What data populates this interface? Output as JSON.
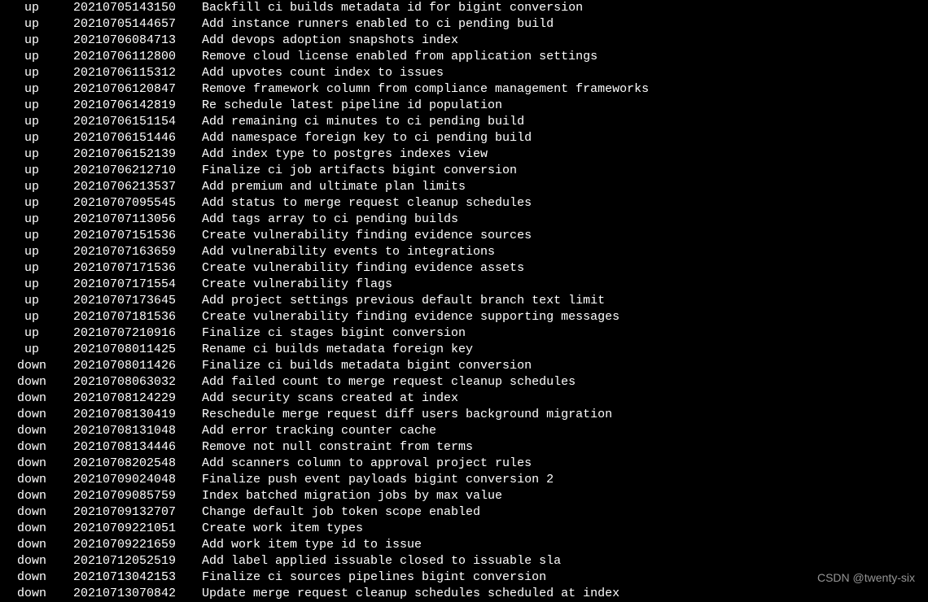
{
  "watermark": "CSDN @twenty-six",
  "rows": [
    {
      "status": "  up",
      "version": "20210705143150",
      "desc": "Backfill ci builds metadata id for bigint conversion"
    },
    {
      "status": "  up",
      "version": "20210705144657",
      "desc": "Add instance runners enabled to ci pending build"
    },
    {
      "status": "  up",
      "version": "20210706084713",
      "desc": "Add devops adoption snapshots index"
    },
    {
      "status": "  up",
      "version": "20210706112800",
      "desc": "Remove cloud license enabled from application settings"
    },
    {
      "status": "  up",
      "version": "20210706115312",
      "desc": "Add upvotes count index to issues"
    },
    {
      "status": "  up",
      "version": "20210706120847",
      "desc": "Remove framework column from compliance management frameworks"
    },
    {
      "status": "  up",
      "version": "20210706142819",
      "desc": "Re schedule latest pipeline id population"
    },
    {
      "status": "  up",
      "version": "20210706151154",
      "desc": "Add remaining ci minutes to ci pending build"
    },
    {
      "status": "  up",
      "version": "20210706151446",
      "desc": "Add namespace foreign key to ci pending build"
    },
    {
      "status": "  up",
      "version": "20210706152139",
      "desc": "Add index type to postgres indexes view"
    },
    {
      "status": "  up",
      "version": "20210706212710",
      "desc": "Finalize ci job artifacts bigint conversion"
    },
    {
      "status": "  up",
      "version": "20210706213537",
      "desc": "Add premium and ultimate plan limits"
    },
    {
      "status": "  up",
      "version": "20210707095545",
      "desc": "Add status to merge request cleanup schedules"
    },
    {
      "status": "  up",
      "version": "20210707113056",
      "desc": "Add tags array to ci pending builds"
    },
    {
      "status": "  up",
      "version": "20210707151536",
      "desc": "Create vulnerability finding evidence sources"
    },
    {
      "status": "  up",
      "version": "20210707163659",
      "desc": "Add vulnerability events to integrations"
    },
    {
      "status": "  up",
      "version": "20210707171536",
      "desc": "Create vulnerability finding evidence assets"
    },
    {
      "status": "  up",
      "version": "20210707171554",
      "desc": "Create vulnerability flags"
    },
    {
      "status": "  up",
      "version": "20210707173645",
      "desc": "Add project settings previous default branch text limit"
    },
    {
      "status": "  up",
      "version": "20210707181536",
      "desc": "Create vulnerability finding evidence supporting messages"
    },
    {
      "status": "  up",
      "version": "20210707210916",
      "desc": "Finalize ci stages bigint conversion"
    },
    {
      "status": "  up",
      "version": "20210708011425",
      "desc": "Rename ci builds metadata foreign key"
    },
    {
      "status": " down",
      "version": "20210708011426",
      "desc": "Finalize ci builds metadata bigint conversion"
    },
    {
      "status": " down",
      "version": "20210708063032",
      "desc": "Add failed count to merge request cleanup schedules"
    },
    {
      "status": " down",
      "version": "20210708124229",
      "desc": "Add security scans created at index"
    },
    {
      "status": " down",
      "version": "20210708130419",
      "desc": "Reschedule merge request diff users background migration"
    },
    {
      "status": " down",
      "version": "20210708131048",
      "desc": "Add error tracking counter cache"
    },
    {
      "status": " down",
      "version": "20210708134446",
      "desc": "Remove not null constraint from terms"
    },
    {
      "status": " down",
      "version": "20210708202548",
      "desc": "Add scanners column to approval project rules"
    },
    {
      "status": " down",
      "version": "20210709024048",
      "desc": "Finalize push event payloads bigint conversion 2"
    },
    {
      "status": " down",
      "version": "20210709085759",
      "desc": "Index batched migration jobs by max value"
    },
    {
      "status": " down",
      "version": "20210709132707",
      "desc": "Change default job token scope enabled"
    },
    {
      "status": " down",
      "version": "20210709221051",
      "desc": "Create work item types"
    },
    {
      "status": " down",
      "version": "20210709221659",
      "desc": "Add work item type id to issue"
    },
    {
      "status": " down",
      "version": "20210712052519",
      "desc": "Add label applied issuable closed to issuable sla"
    },
    {
      "status": " down",
      "version": "20210713042153",
      "desc": "Finalize ci sources pipelines bigint conversion"
    },
    {
      "status": " down",
      "version": "20210713070842",
      "desc": "Update merge request cleanup schedules scheduled at index"
    }
  ]
}
